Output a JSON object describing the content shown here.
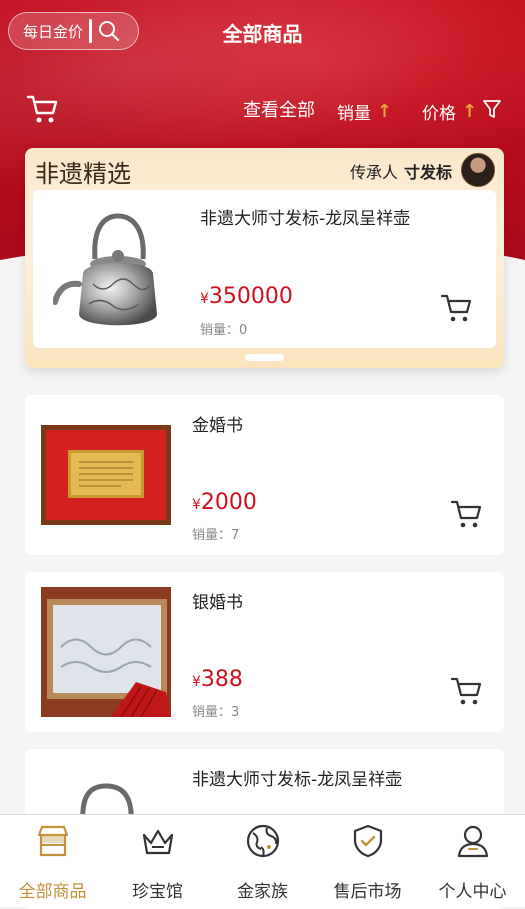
{
  "header": {
    "title": "全部商品",
    "search_label": "每日金价",
    "view_all": "查看全部",
    "sort_sales": "销量",
    "sort_price": "价格",
    "arrow": "↑"
  },
  "featured": {
    "section_title": "非遗精选",
    "inheritor_label": "传承人",
    "inheritor_name": "寸发标",
    "product": {
      "name": "非遗大师寸发标-龙凤呈祥壶",
      "currency": "¥",
      "price": "350000",
      "sales": "销量：0"
    }
  },
  "products": [
    {
      "name": "金婚书",
      "currency": "¥",
      "price": "2000",
      "sales": "销量：7"
    },
    {
      "name": "银婚书",
      "currency": "¥",
      "price": "388",
      "sales": "销量：3"
    },
    {
      "name": "非遗大师寸发标-龙凤呈祥壶"
    }
  ],
  "tabs": [
    {
      "label": "全部商品",
      "icon": "shop-icon",
      "active": true
    },
    {
      "label": "珍宝馆",
      "icon": "crown-icon"
    },
    {
      "label": "金家族",
      "icon": "globe-icon"
    },
    {
      "label": "售后市场",
      "icon": "shield-check-icon"
    },
    {
      "label": "个人中心",
      "icon": "user-icon"
    }
  ],
  "colors": {
    "brand_red": "#c4101f",
    "price_red": "#d0101a",
    "gold": "#c4923c",
    "accent_arrow": "#e8a43a"
  }
}
